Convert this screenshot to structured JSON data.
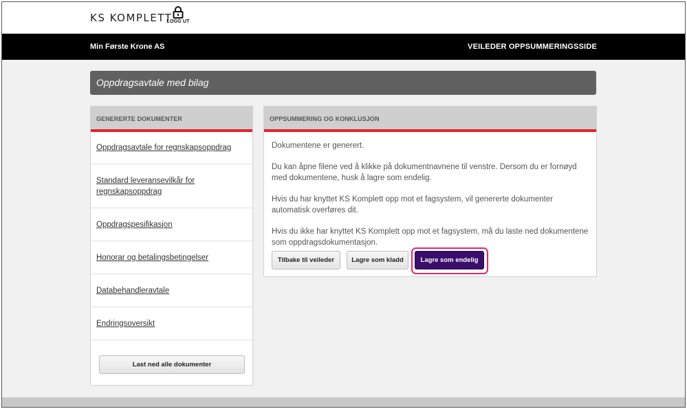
{
  "header": {
    "logo": "KS KOMPLETT",
    "logout_label": "LOGG UT"
  },
  "navbar": {
    "company": "Min Første Krone AS",
    "page_label": "VEILEDER OPPSUMMERINGSSIDE"
  },
  "title_bar": "Oppdragsavtale med bilag",
  "left_panel": {
    "title": "GENERERTE DOKUMENTER",
    "documents": [
      "Oppdragsavtale for regnskapsoppdrag",
      "Standard leveransevilkår for regnskapsoppdrag",
      "Oppdragspesifikasjon",
      "Honorar og betalingsbetingelser",
      "Databehandleravtale",
      "Endringsoversikt"
    ],
    "download_all": "Last ned alle dokumenter"
  },
  "right_panel": {
    "title": "OPPSUMMERING OG KONKLUSJON",
    "paragraphs": [
      "Dokumentene er generert.",
      "Du kan åpne filene ved å klikke på dokumentnavnene til venstre. Dersom du er fornøyd med dokumentene, husk å lagre som endelig.",
      "Hvis du har knyttet KS Komplett opp mot et fagsystem, vil genererte dokumenter automatisk overføres dit.",
      "Hvis du ikke har knyttet KS Komplett opp mot et fagsystem, må du laste ned dokumentene som oppdragsdokumentasjon."
    ],
    "buttons": {
      "back": "Tilbake til veileder",
      "draft": "Lagre som kladd",
      "final": "Lagre som endelig"
    }
  },
  "colors": {
    "accent_red": "#e4222b",
    "primary_button": "#3b0e6b",
    "highlight_border": "#e0286a"
  }
}
